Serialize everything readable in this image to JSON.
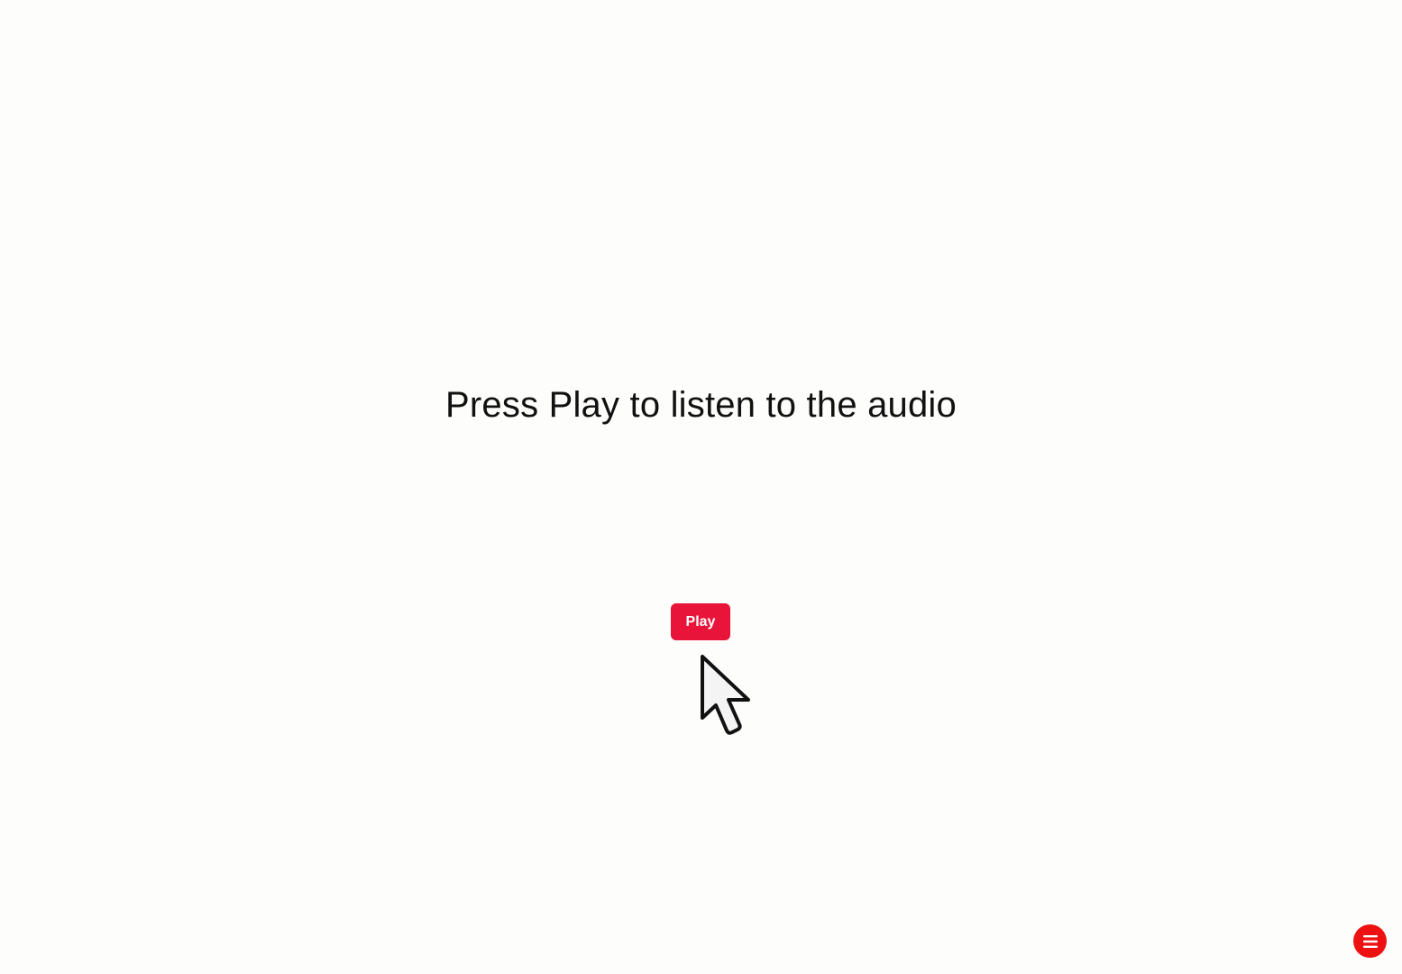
{
  "main": {
    "heading": "Press Play to listen to the audio",
    "play_button_label": "Play"
  },
  "floating_menu": {
    "icon": "menu-icon"
  },
  "colors": {
    "background": "#fdfdfc",
    "play_button": "#e8143a",
    "menu_button": "#ee1111",
    "text": "#111111"
  }
}
